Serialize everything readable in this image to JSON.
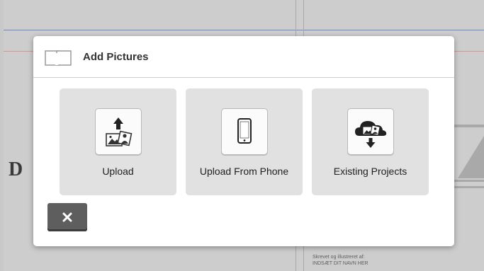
{
  "background": {
    "decorative_letter": "D",
    "credit_line1": "Skrevet og illustreret af:",
    "credit_line2": "INDSÆT DIT NAVN HER"
  },
  "modal": {
    "title": "Add Pictures",
    "header_icon": "pictures-icon",
    "options": [
      {
        "label": "Upload",
        "icon": "upload-photos-icon"
      },
      {
        "label": "Upload From Phone",
        "icon": "phone-icon"
      },
      {
        "label": "Existing Projects",
        "icon": "cloud-download-icon"
      }
    ],
    "close_icon": "close-icon"
  },
  "colors": {
    "tile_bg": "#e1e1e1",
    "close_bg": "#5e5e5e",
    "overlay_bg": "#c9c9c9"
  }
}
